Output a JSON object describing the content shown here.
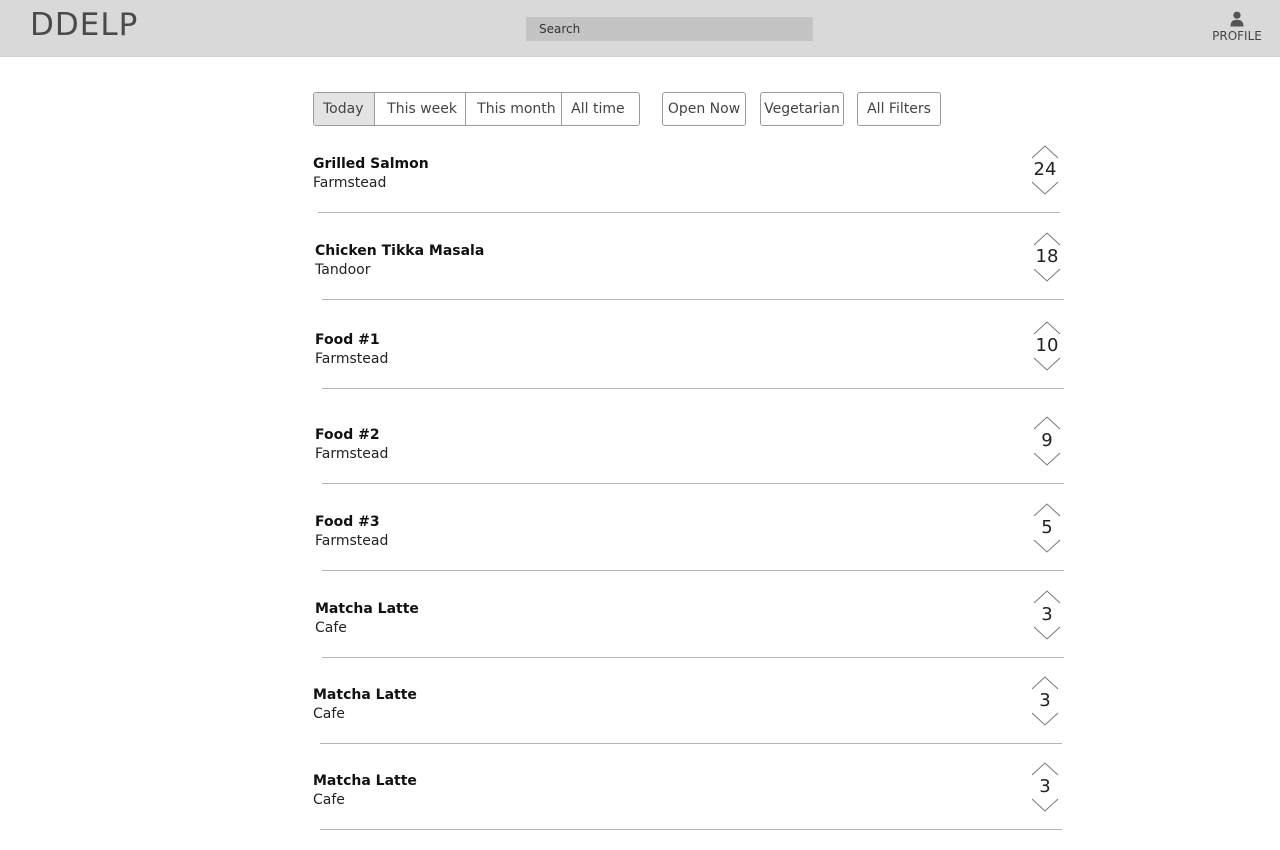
{
  "header": {
    "logo": "DDELP",
    "search_placeholder": "Search",
    "profile_label": "PROFILE",
    "profile_icon": "user-icon"
  },
  "time_filters": {
    "options": [
      "Today",
      "This week",
      "This month",
      "All time"
    ],
    "selected": "Today"
  },
  "filter_buttons": [
    "Open Now",
    "Vegetarian",
    "All Filters"
  ],
  "items": [
    {
      "name": "Grilled Salmon",
      "place": "Farmstead",
      "votes": "24"
    },
    {
      "name": "Chicken Tikka Masala",
      "place": "Tandoor",
      "votes": "18"
    },
    {
      "name": "Food #1",
      "place": "Farmstead",
      "votes": "10"
    },
    {
      "name": "Food #2",
      "place": "Farmstead",
      "votes": "9"
    },
    {
      "name": "Food #3",
      "place": "Farmstead",
      "votes": "5"
    },
    {
      "name": "Matcha Latte",
      "place": "Cafe",
      "votes": "3"
    },
    {
      "name": "Matcha Latte",
      "place": "Cafe",
      "votes": "3"
    },
    {
      "name": "Matcha Latte",
      "place": "Cafe",
      "votes": "3"
    }
  ],
  "colors": {
    "header_bg": "#d9d9d9",
    "search_bg": "#c4c4c4",
    "active_filter_bg": "#e3e3e3",
    "divider": "#b5b5b5"
  }
}
